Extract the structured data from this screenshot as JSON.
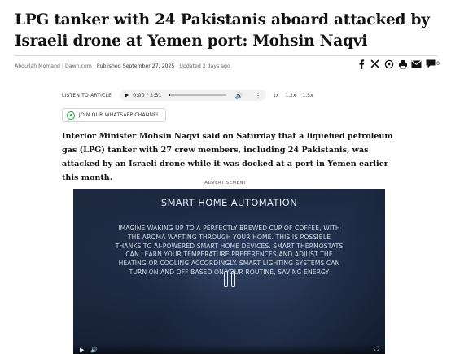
{
  "article": {
    "headline": "LPG tanker with 24 Pakistanis aboard attacked by Israeli drone at Yemen port: Mohsin Naqvi",
    "author": "Abdullah Momand",
    "outlet": "Dawn.com",
    "published": "Published September 27, 2025",
    "updated": "Updated 2 days ago",
    "lede": "Interior Minister Mohsin Naqvi said on Saturday that a liquefied petroleum gas (LPG) tanker with 27 crew members, including 24 Pakistanis, was attacked by an Israeli drone while it was docked at a port in Yemen earlier this month."
  },
  "share": {
    "icons": [
      "facebook-icon",
      "x-icon",
      "whatsapp-icon",
      "print-icon",
      "email-icon",
      "comments-icon"
    ],
    "comment_count": "0"
  },
  "audio": {
    "listen_label": "LISTEN TO ARTICLE",
    "time": "0:00 / 2:31",
    "progress": 0.0,
    "speeds": [
      "1x",
      "1.2x",
      "1.5x"
    ]
  },
  "whatsapp": {
    "label": "JOIN OUR WHATSAPP CHANNEL"
  },
  "ad": {
    "label": "ADVERTISEMENT",
    "video_title": "SMART HOME AUTOMATION",
    "video_body": "IMAGINE WAKING UP TO A PERFECTLY BREWED CUP OF COFFEE, WITH THE AROMA WAFTING THROUGH YOUR HOME. THIS IS POSSIBLE THANKS TO AI-POWERED SMART HOME DEVICES. SMART THERMOSTATS CAN LEARN YOUR TEMPERATURE PREFERENCES AND ADJUST THE HEATING OR COOLING ACCORDINGLY. SMART LIGHTING SYSTEMS CAN TURN ON AND OFF BASED ON YOUR ROUTINE, SAVING ENERGY"
  },
  "colors": {
    "whatsapp_green": "#25a244",
    "rule": "#d8d8d8",
    "video_bg": "#1c2740"
  }
}
